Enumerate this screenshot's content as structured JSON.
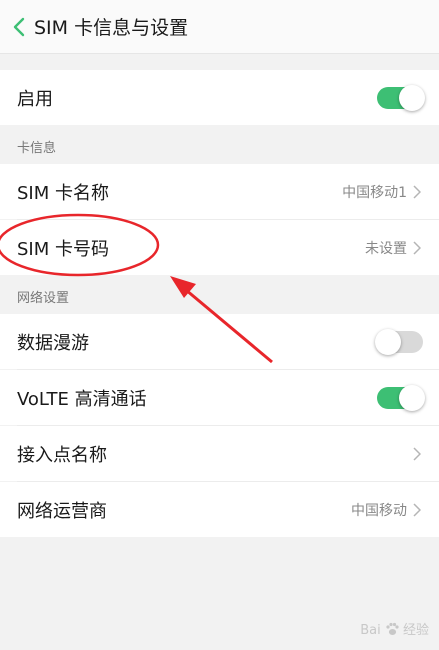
{
  "header": {
    "title": "SIM 卡信息与设置"
  },
  "enable": {
    "label": "启用",
    "toggle": "on"
  },
  "card_info": {
    "section_label": "卡信息",
    "name_label": "SIM 卡名称",
    "name_value": "中国移动1",
    "number_label": "SIM 卡号码",
    "number_value": "未设置"
  },
  "network": {
    "section_label": "网络设置",
    "roaming_label": "数据漫游",
    "roaming_toggle": "off",
    "volte_label": "VoLTE 高清通话",
    "volte_toggle": "on",
    "apn_label": "接入点名称",
    "operator_label": "网络运营商",
    "operator_value": "中国移动"
  },
  "annotation_color": "#e8262b",
  "toggle_on_color": "#3dbf74",
  "icons": [
    "back-icon",
    "chevron-right-icon",
    "baidu-paw-icon"
  ],
  "watermark": {
    "brand": "Bai",
    "suffix": "经验"
  }
}
